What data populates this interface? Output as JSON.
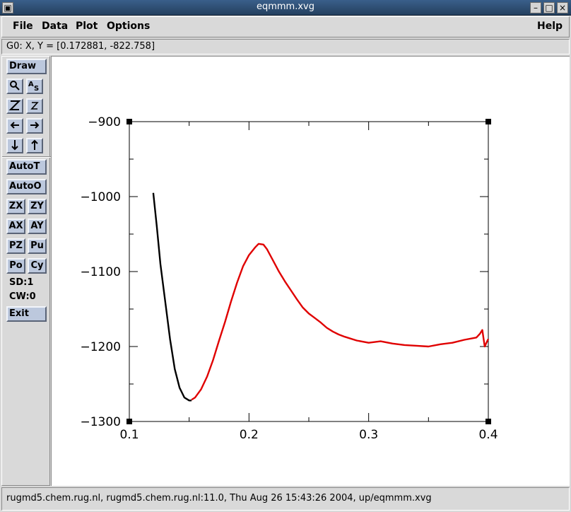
{
  "window": {
    "title": "eqmmm.xvg",
    "menu_icon": "window-menu-icon"
  },
  "menu": {
    "file": "File",
    "data": "Data",
    "plot": "Plot",
    "options": "Options",
    "help": "Help"
  },
  "coord_readout": "G0: X, Y = [0.172881, -822.758]",
  "toolbar": {
    "draw": "Draw",
    "auto_t": "AutoT",
    "auto_o": "AutoO",
    "zx": "ZX",
    "zy": "ZY",
    "ax": "AX",
    "ay": "AY",
    "pz": "PZ",
    "pu": "Pu",
    "po": "Po",
    "cy": "Cy",
    "sd": "SD:1",
    "cw": "CW:0",
    "exit": "Exit",
    "icons": [
      "zoom-icon",
      "autoscale-icon",
      "zoom-in-icon",
      "zoom-out-icon",
      "left-arrow-icon",
      "right-arrow-icon",
      "down-arrow-icon",
      "up-arrow-icon"
    ]
  },
  "status": "rugmd5.chem.rug.nl, rugmd5.chem.rug.nl:11.0, Thu Aug 26 15:43:26 2004, up/eqmmm.xvg",
  "chart_data": {
    "type": "line",
    "title": "",
    "xlabel": "",
    "ylabel": "",
    "xlim": [
      0.1,
      0.4
    ],
    "ylim": [
      -1300,
      -900
    ],
    "xticks": [
      "0.1",
      "0.2",
      "0.3",
      "0.4"
    ],
    "yticks": [
      "-900",
      "-1000",
      "-1100",
      "-1200",
      "-1300"
    ],
    "series": [
      {
        "color": "#000000",
        "x": [
          0.12,
          0.123,
          0.126,
          0.13,
          0.134,
          0.138,
          0.142,
          0.146,
          0.15,
          0.152
        ],
        "y": [
          -995,
          -1040,
          -1090,
          -1140,
          -1190,
          -1230,
          -1255,
          -1268,
          -1272,
          -1272
        ]
      },
      {
        "color": "#e00000",
        "x": [
          0.152,
          0.155,
          0.16,
          0.165,
          0.17,
          0.175,
          0.18,
          0.185,
          0.19,
          0.195,
          0.2,
          0.205,
          0.208,
          0.212,
          0.215,
          0.22,
          0.225,
          0.23,
          0.235,
          0.24,
          0.245,
          0.25,
          0.255,
          0.26,
          0.265,
          0.27,
          0.275,
          0.28,
          0.29,
          0.3,
          0.31,
          0.32,
          0.33,
          0.34,
          0.35,
          0.36,
          0.37,
          0.38,
          0.39,
          0.393,
          0.395,
          0.397,
          0.399,
          0.4
        ],
        "y": [
          -1271,
          -1268,
          -1257,
          -1240,
          -1218,
          -1192,
          -1167,
          -1140,
          -1115,
          -1093,
          -1078,
          -1068,
          -1063,
          -1064,
          -1070,
          -1085,
          -1100,
          -1113,
          -1125,
          -1137,
          -1148,
          -1156,
          -1162,
          -1168,
          -1175,
          -1180,
          -1184,
          -1187,
          -1192,
          -1195,
          -1193,
          -1196,
          -1198,
          -1199,
          -1200,
          -1197,
          -1195,
          -1191,
          -1188,
          -1183,
          -1178,
          -1200,
          -1193,
          -1190
        ]
      }
    ]
  }
}
